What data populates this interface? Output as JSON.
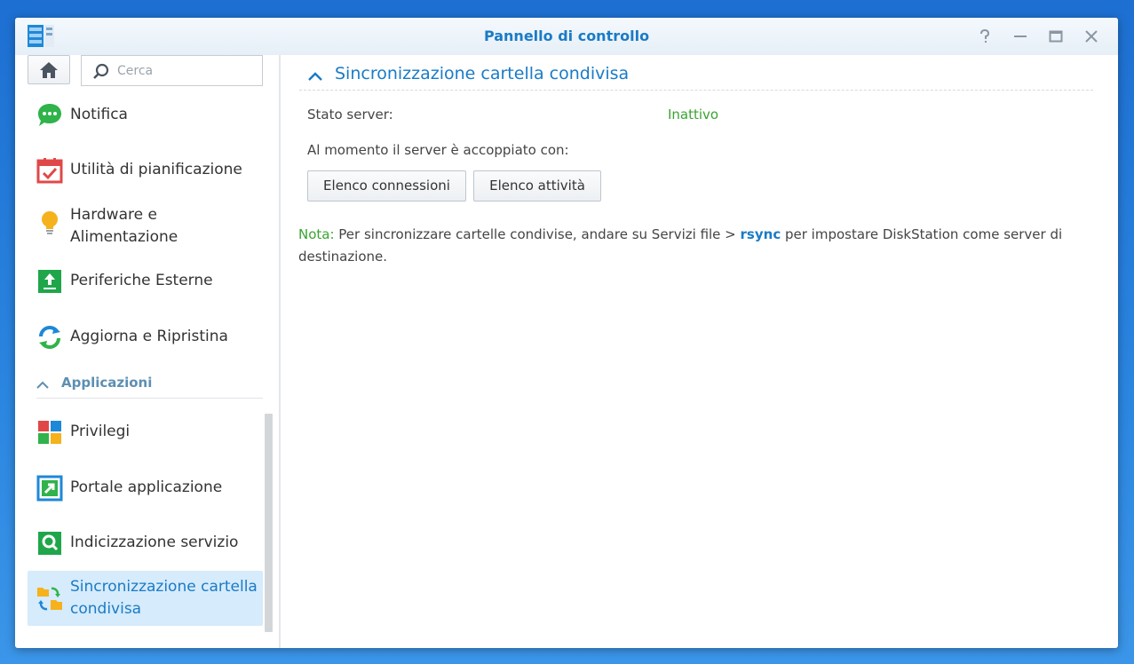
{
  "window": {
    "title": "Pannello di controllo"
  },
  "search": {
    "placeholder": "Cerca"
  },
  "sidebar": {
    "items": [
      {
        "label": "Notifica",
        "icon": "notification-icon"
      },
      {
        "label": "Utilità di pianificazione",
        "icon": "calendar-check-icon"
      },
      {
        "label": "Hardware e Alimentazione",
        "icon": "lightbulb-icon"
      },
      {
        "label": "Periferiche Esterne",
        "icon": "external-device-icon"
      },
      {
        "label": "Aggiorna e Ripristina",
        "icon": "update-restore-icon"
      }
    ],
    "section_label": "Applicazioni",
    "app_items": [
      {
        "label": "Privilegi",
        "icon": "privileges-icon"
      },
      {
        "label": "Portale applicazione",
        "icon": "app-portal-icon"
      },
      {
        "label": "Indicizzazione servizio",
        "icon": "indexing-icon"
      },
      {
        "label": "Sincronizzazione cartella condivisa",
        "icon": "shared-folder-sync-icon",
        "active": true
      }
    ]
  },
  "main": {
    "section_title": "Sincronizzazione cartella condivisa",
    "server_status_label": "Stato server:",
    "server_status_value": "Inattivo",
    "paired_label": "Al momento il server è accoppiato con:",
    "buttons": {
      "connections": "Elenco connessioni",
      "tasks": "Elenco attività"
    },
    "note": {
      "prefix": "Nota:",
      "text_before": " Per sincronizzare cartelle condivise, andare su Servizi file > ",
      "link": "rsync",
      "text_after": " per impostare DiskStation come server di destinazione."
    }
  },
  "colors": {
    "accent": "#1a7bc6",
    "status_green": "#39a430",
    "active_item_bg": "#d6ebfb"
  }
}
